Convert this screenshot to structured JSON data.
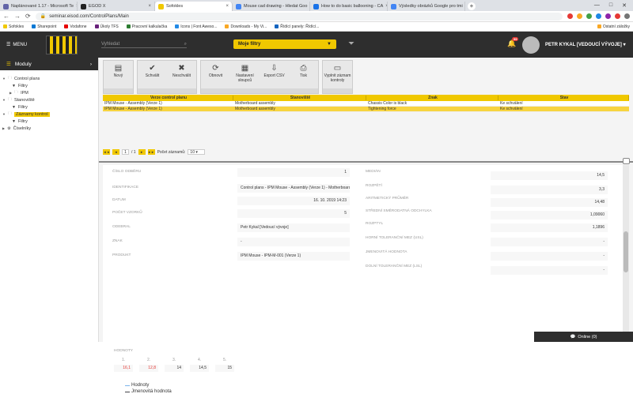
{
  "browser": {
    "tabs": [
      {
        "label": "Naplánované 1.17 - Microsoft Te",
        "color": "#6264a7",
        "active": false
      },
      {
        "label": "EGOD X",
        "color": "#222222",
        "active": false
      },
      {
        "label": "Sofokles",
        "color": "#f0c800",
        "active": true
      },
      {
        "label": "Mouse cad drawing - Hledat Goo",
        "color": "#4285f4",
        "active": false
      },
      {
        "label": "How to do basic ballooning - CA",
        "color": "#1a73e8",
        "active": false
      },
      {
        "label": "Výsledky obrázků Google pro tmi",
        "color": "#4285f4",
        "active": false
      }
    ],
    "url": "seminar.eisod.com/ControlPlans/Main",
    "bookmarks": [
      {
        "label": "Sofokles",
        "color": "#f0c800"
      },
      {
        "label": "Sharepoint",
        "color": "#0078d4"
      },
      {
        "label": "Vodafone",
        "color": "#e60000"
      },
      {
        "label": "Úkoly TFS",
        "color": "#68217a"
      },
      {
        "label": "Pracovní kalkulačka",
        "color": "#2e7d32"
      },
      {
        "label": "Icons | Font Aweso...",
        "color": "#228ae6"
      },
      {
        "label": "Downloads - My Vi...",
        "color": "#f9a825"
      },
      {
        "label": "Řídící panely: Řídící...",
        "color": "#1565c0"
      }
    ],
    "other_bookmarks": "Ostatní záložky"
  },
  "header": {
    "menu_label": "MENU",
    "search_placeholder": "Vyhledat",
    "filter_label": "Moje filtry",
    "notif_count": "99",
    "user_name": "PETR KYKAL [VEDOUCÍ VÝVOJE]"
  },
  "sidebar": {
    "title": "Moduly",
    "items": [
      {
        "label": "Control plans",
        "level": 0,
        "icon": "folder"
      },
      {
        "label": "Filtry",
        "level": 1,
        "icon": "filter"
      },
      {
        "label": "IPM",
        "level": 1,
        "icon": "folder"
      },
      {
        "label": "Stanoviště",
        "level": 0,
        "icon": "folder"
      },
      {
        "label": "Filtry",
        "level": 1,
        "icon": "filter"
      },
      {
        "label": "Záznamy kontrol",
        "level": 0,
        "icon": "folder",
        "selected": true
      },
      {
        "label": "Filtry",
        "level": 1,
        "icon": "filter"
      },
      {
        "label": "Číselníky",
        "level": 0,
        "icon": "gears"
      }
    ]
  },
  "toolbar": [
    {
      "buttons": [
        {
          "label": "Nový",
          "icon": "▤"
        }
      ]
    },
    {
      "buttons": [
        {
          "label": "Schválit",
          "icon": "✔"
        },
        {
          "label": "Neschválit",
          "icon": "✖"
        }
      ]
    },
    {
      "buttons": [
        {
          "label": "Obnovit",
          "icon": "⟳"
        },
        {
          "label": "Nastavení sloupců",
          "icon": "▦"
        },
        {
          "label": "Export CSV",
          "icon": "⇩"
        },
        {
          "label": "Tisk",
          "icon": "⎙"
        }
      ]
    },
    {
      "buttons": [
        {
          "label": "Vyplnit záznam kontroly",
          "icon": "▭"
        }
      ]
    }
  ],
  "grid": {
    "columns": [
      "Verze control planu",
      "Stanoviště",
      "Znak",
      "Stav"
    ],
    "rows": [
      {
        "cells": [
          "IPM Mouse - Assembly (Verze 1)",
          "Motherboard assembly",
          "Chassis Color is black",
          "Ke schválení"
        ],
        "selected": false
      },
      {
        "cells": [
          "IPM Mouse - Assembly (Verze 1)",
          "Motherboard assembly",
          "Tightening force",
          "Ke schválení"
        ],
        "selected": true
      }
    ]
  },
  "pager": {
    "first": "◄◄",
    "prev": "◄",
    "page": "1",
    "of": "/ 1",
    "next": "►",
    "last": "►►",
    "size_label": "Počet záznamů:",
    "size": "10"
  },
  "detail": {
    "left": [
      {
        "label": "Číslo odběru",
        "value": "1"
      },
      {
        "label": "Identifikace",
        "value": "Control plans - IPM Mouse - Assembly (Verze 1) - Motherboard a"
      },
      {
        "label": "Datum",
        "value": "16. 10. 2019 14:23"
      },
      {
        "label": "Počet vzorků",
        "value": "5"
      },
      {
        "label": "Odebral",
        "value": "Petr Kykal [Vedoucí vývoje]"
      },
      {
        "label": "Znak",
        "value": "-"
      },
      {
        "label": "Produkt",
        "value": "IPM Mouse - IPM-M-001 (Verze 1)"
      }
    ],
    "right": [
      {
        "label": "Medián",
        "value": "14,5"
      },
      {
        "label": "Rozpětí",
        "value": "3,3"
      },
      {
        "label": "Aritmetický průměr",
        "value": "14,48"
      },
      {
        "label": "Střední směrodatná odchylka",
        "value": "1,09060"
      },
      {
        "label": "Rozptyl",
        "value": "1,1896"
      },
      {
        "label": "Horní toleranční mez (USL)",
        "value": "-"
      },
      {
        "label": "Jmenovitá hodnota",
        "value": "-"
      },
      {
        "label": "Dolní toleranční mez (LSL)",
        "value": "-"
      }
    ],
    "hodnoty_label": "HODNOTY",
    "hodnoty": [
      {
        "idx": "1.",
        "value": "16,1",
        "red": true
      },
      {
        "idx": "2.",
        "value": "12,8",
        "red": true
      },
      {
        "idx": "3.",
        "value": "14",
        "red": false
      },
      {
        "idx": "4.",
        "value": "14,5",
        "red": false
      },
      {
        "idx": "5.",
        "value": "15",
        "red": false
      }
    ],
    "legend": [
      {
        "label": "Hodnoty",
        "color": "#7cb5ec"
      },
      {
        "label": "Jmenovitá hodnota",
        "color": "#434348"
      }
    ]
  },
  "online": "Online (0)"
}
